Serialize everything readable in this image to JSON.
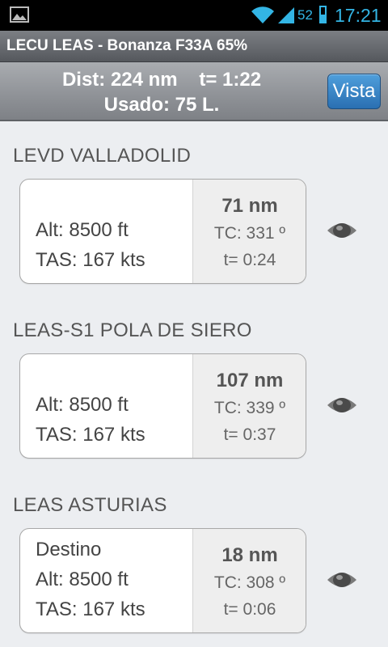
{
  "status_bar": {
    "battery": "52",
    "time": "17:21"
  },
  "title_bar": {
    "title": "LECU LEAS - Bonanza F33A 65%"
  },
  "summary": {
    "dist": "Dist: 224 nm",
    "time": "t= 1:22",
    "used": "Usado: 75 L.",
    "vista_label": "Vista"
  },
  "legs": [
    {
      "name": "LEVD VALLADOLID",
      "note": "",
      "alt": "Alt: 8500 ft",
      "tas": "TAS: 167 kts",
      "dist": "71 nm",
      "tc": "TC: 331 º",
      "time": "t= 0:24"
    },
    {
      "name": "LEAS-S1 POLA DE SIERO",
      "note": "",
      "alt": "Alt: 8500 ft",
      "tas": "TAS: 167 kts",
      "dist": "107 nm",
      "tc": "TC: 339 º",
      "time": "t= 0:37"
    },
    {
      "name": "LEAS ASTURIAS",
      "note": "Destino",
      "alt": "Alt: 8500 ft",
      "tas": "TAS: 167 kts",
      "dist": "18 nm",
      "tc": "TC: 308 º",
      "time": "t= 0:06"
    }
  ],
  "colors": {
    "accent": "#33b5e5",
    "button": "#2f7ec0"
  }
}
